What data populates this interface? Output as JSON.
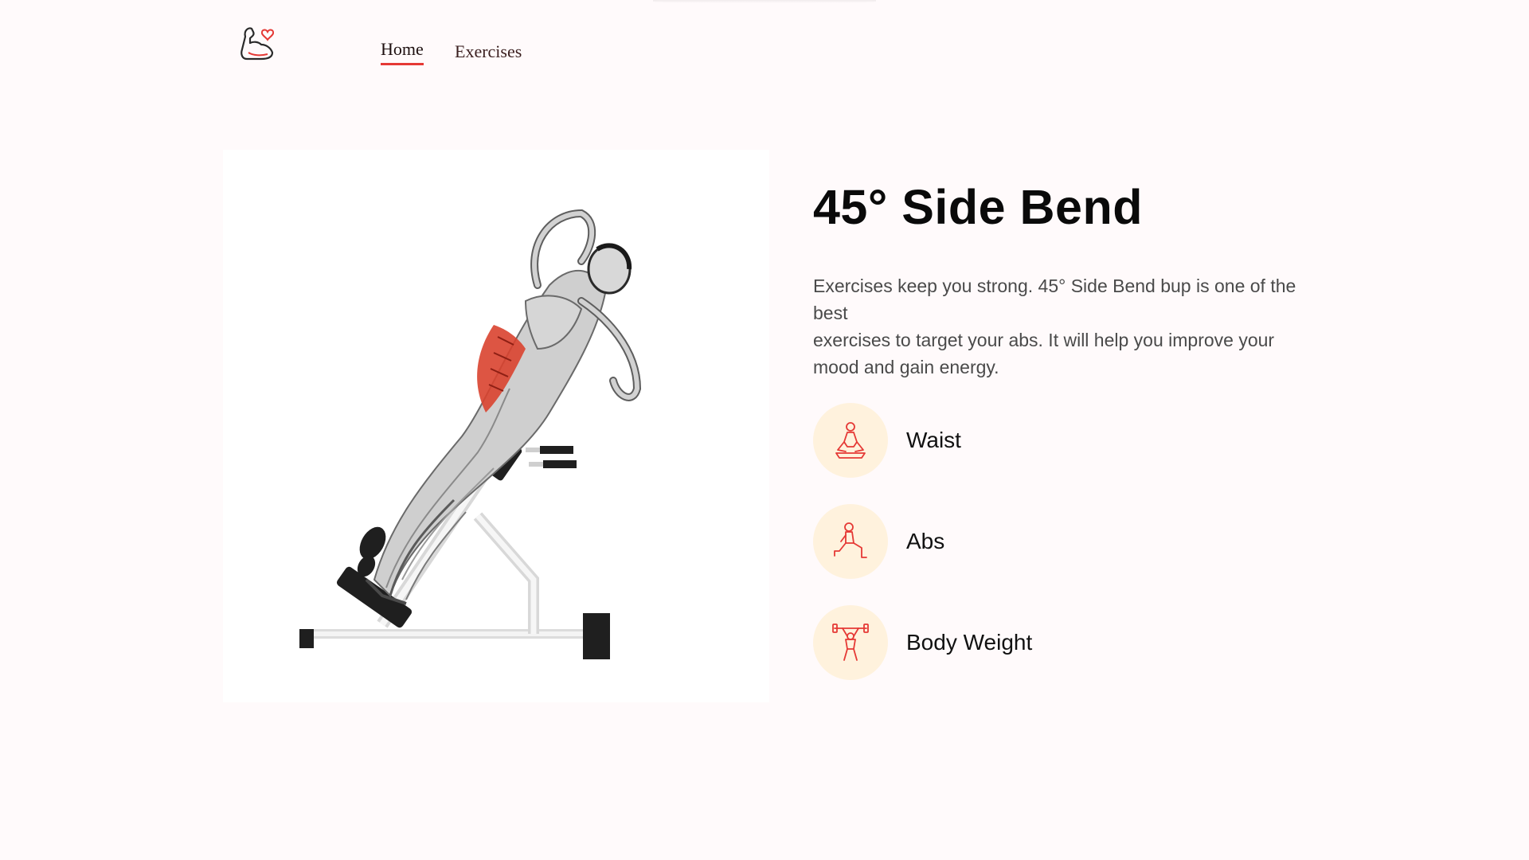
{
  "nav": {
    "logo_icon": "flexed-arm-heart-icon",
    "links": [
      {
        "label": "Home",
        "active": true
      },
      {
        "label": "Exercises",
        "active": false
      }
    ]
  },
  "exercise": {
    "image_icon": "side-bend-illustration",
    "title": "45° Side Bend",
    "description_lines": [
      "Exercises keep you strong. 45° Side Bend bup is one of the best",
      "exercises to target your abs. It will help you improve your mood and gain energy."
    ],
    "tags": [
      {
        "label": "Waist",
        "icon": "meditation-icon"
      },
      {
        "label": "Abs",
        "icon": "lunge-icon"
      },
      {
        "label": "Body Weight",
        "icon": "weightlifter-icon"
      }
    ]
  },
  "colors": {
    "accent": "#e53935",
    "background": "#fffafb",
    "tag_circle": "#fff2dd",
    "muscle_highlight": "#d9432f"
  }
}
